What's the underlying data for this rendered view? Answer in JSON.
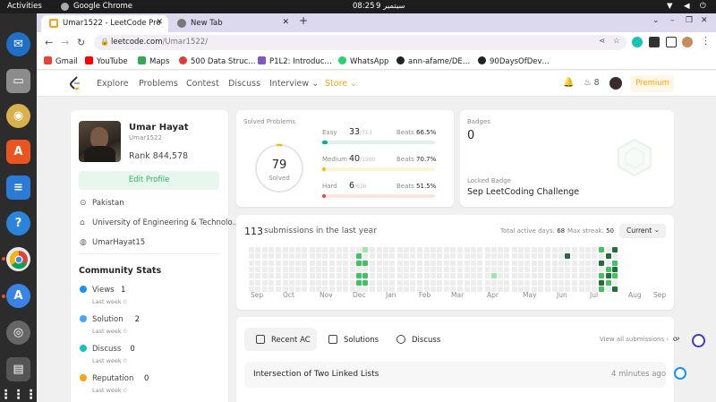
{
  "system": {
    "activities": "Activities",
    "app": "Google Chrome",
    "clock": "08:25",
    "date": "9 سبتمبر"
  },
  "tabs": [
    {
      "title": "Umar1522 - LeetCode Pro",
      "close": "✕"
    },
    {
      "title": "New Tab",
      "close": "✕"
    }
  ],
  "new_tab": "+",
  "window_controls": {
    "dropdown": "⌄",
    "minimize": "–",
    "restore": "❐",
    "close": "✕"
  },
  "address": {
    "host": "leetcode.com",
    "path": "/Umar1522/"
  },
  "bookmarks": [
    "Gmail",
    "YouTube",
    "Maps",
    "500 Data Struc…",
    "P1L2: Introduc…",
    "WhatsApp",
    "ann-afame/DE…",
    "90DaysOfDev…"
  ],
  "bookmark_colors": [
    "#ea4335",
    "#ff0000",
    "#34a853",
    "#e53935",
    "#7e57c2",
    "#25d366",
    "#222222",
    "#222222"
  ],
  "lc_nav": {
    "explore": "Explore",
    "problems": "Problems",
    "contest": "Contest",
    "discuss": "Discuss",
    "interview": "Interview",
    "store": "Store",
    "streak": "8",
    "premium": "Premium"
  },
  "profile": {
    "name": "Umar Hayat",
    "username": "Umar1522",
    "rank": "Rank 844,578",
    "edit": "Edit Profile",
    "location": "Pakistan",
    "school": "University of Engineering & Technolo…",
    "github": "UmarHayat15"
  },
  "community": {
    "title": "Community Stats",
    "items": [
      {
        "label": "Views",
        "value": "1",
        "sub": "Last week",
        "delta": "0",
        "color": "#1890ff"
      },
      {
        "label": "Solution",
        "value": "2",
        "sub": "Last week",
        "delta": "0",
        "color": "#40a9ff"
      },
      {
        "label": "Discuss",
        "value": "0",
        "sub": "Last week",
        "delta": "0",
        "color": "#13c2c2"
      },
      {
        "label": "Reputation",
        "value": "0",
        "sub": "Last week",
        "delta": "0",
        "color": "#ffa116"
      }
    ]
  },
  "solved": {
    "title": "Solved Problems",
    "total": "79",
    "total_label": "Solved",
    "rows": [
      {
        "level": "Easy",
        "count": "33",
        "of": "/713",
        "beats_label": "Beats",
        "beats": "66.5%",
        "fill": 0.05,
        "color": "#00af9b",
        "track": "#d9f2ec"
      },
      {
        "level": "Medium",
        "count": "40",
        "of": "/1500",
        "beats_label": "Beats",
        "beats": "70.7%",
        "fill": 0.03,
        "color": "#ffb800",
        "track": "#fff3d6"
      },
      {
        "level": "Hard",
        "count": "6",
        "of": "/626",
        "beats_label": "Beats",
        "beats": "51.5%",
        "fill": 0.01,
        "color": "#ef4743",
        "track": "#fde3e2"
      }
    ]
  },
  "badges": {
    "title": "Badges",
    "count": "0",
    "locked_label": "Locked Badge",
    "locked_name": "Sep LeetCoding Challenge"
  },
  "submissions": {
    "count": "113",
    "label": "submissions in the last year",
    "active_days_label": "Total active days:",
    "active_days": "68",
    "max_streak_label": "Max streak:",
    "max_streak": "50",
    "period": "Current",
    "months": [
      "Sep",
      "Oct",
      "Nov",
      "Dec",
      "Jan",
      "Feb",
      "Mar",
      "Apr",
      "May",
      "Jun",
      "Jul",
      "Aug",
      "Sep"
    ]
  },
  "recent": {
    "tabs": [
      "Recent AC",
      "Solutions",
      "Discuss"
    ],
    "view_all": "View all submissions",
    "items": [
      {
        "title": "Intersection of Two Linked Lists",
        "time": "4 minutes ago"
      }
    ]
  }
}
